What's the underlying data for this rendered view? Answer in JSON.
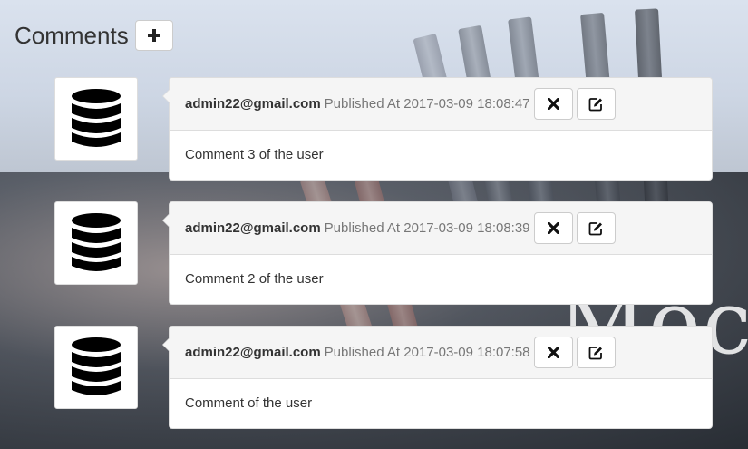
{
  "page": {
    "title": "Comments",
    "background_text": "Mock"
  },
  "comments": [
    {
      "author": "admin22@gmail.com",
      "published": "Published At 2017-03-09 18:08:47",
      "body": "Comment 3 of the user"
    },
    {
      "author": "admin22@gmail.com",
      "published": "Published At 2017-03-09 18:08:39",
      "body": "Comment 2 of the user"
    },
    {
      "author": "admin22@gmail.com",
      "published": "Published At 2017-03-09 18:07:58",
      "body": "Comment of the user"
    }
  ],
  "icons": {
    "add": "plus-icon",
    "avatar": "database-icon",
    "delete": "times-icon",
    "edit": "edit-icon"
  },
  "colors": {
    "panel_header": "#f5f5f5",
    "border": "#dddddd",
    "muted_text": "#777777"
  }
}
